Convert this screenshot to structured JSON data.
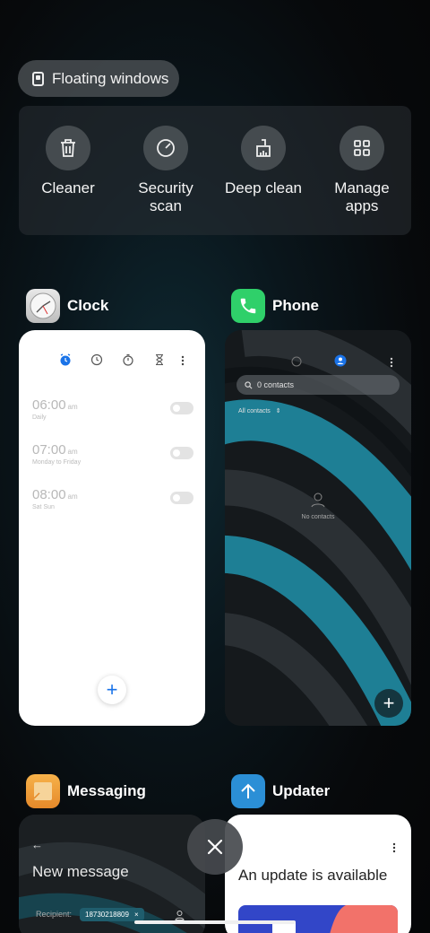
{
  "floating": {
    "label": "Floating windows"
  },
  "tools": [
    {
      "label": "Cleaner",
      "icon": "trash-icon"
    },
    {
      "label": "Security\nscan",
      "icon": "gauge-icon"
    },
    {
      "label": "Deep clean",
      "icon": "brush-icon"
    },
    {
      "label": "Manage\napps",
      "icon": "grid-icon"
    }
  ],
  "apps": {
    "clock": {
      "name": "Clock",
      "alarms": [
        {
          "time": "06:00",
          "ampm": "am",
          "repeat": "Daily"
        },
        {
          "time": "07:00",
          "ampm": "am",
          "repeat": "Monday to Friday"
        },
        {
          "time": "08:00",
          "ampm": "am",
          "repeat": "Sat Sun"
        }
      ],
      "add_label": "+",
      "accent": "#1a73e8"
    },
    "phone": {
      "name": "Phone",
      "search_placeholder": "0 contacts",
      "filter": "All contacts",
      "empty": "No contacts",
      "add_label": "+"
    },
    "messaging": {
      "name": "Messaging",
      "title": "New message",
      "recipient_label": "Recipient:",
      "recipient_value": "18730218809",
      "chip_close": "×"
    },
    "updater": {
      "name": "Updater",
      "title": "An update is available"
    }
  },
  "colors": {
    "phone_icon": "#2fd06a",
    "updater_icon": "#2b8fd6",
    "messaging_icon": "#f39a2b",
    "teal": "#1e7f95"
  }
}
